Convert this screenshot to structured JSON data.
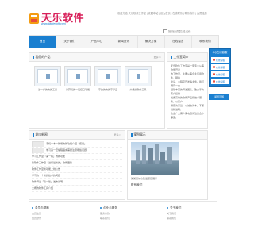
{
  "brand": {
    "title": "天乐软件",
    "subtitle": "www.tianlesoft.com"
  },
  "top_links": "欢迎光临 天乐软件工作室 | 收藏本站 | 设为首页 | 在线联系 | 联系我们 | 会员注册",
  "contact": {
    "email": "tianlesoft@163.com"
  },
  "nav": [
    {
      "label": "首页",
      "active": true
    },
    {
      "label": "关于我们"
    },
    {
      "label": "产品中心"
    },
    {
      "label": "新闻资讯"
    },
    {
      "label": "解决方案"
    },
    {
      "label": "在线留言"
    },
    {
      "label": "联系我们"
    }
  ],
  "products": {
    "title": "我们的产品",
    "more": "更多>>",
    "items": [
      {
        "label": "进一步的的的工具"
      },
      {
        "label": "计算机的一般接口功能"
      },
      {
        "label": "字的的的的字产品"
      },
      {
        "label": "大概的软件工具"
      }
    ]
  },
  "intro": {
    "title": "工作室简介",
    "more": "更多>>",
    "lines": [
      "天乐软件工作室是一家专业从事软件开发",
      "的工作室，主要从事企业应用软件、网站",
      "建设、小程序开发等业务。我们拥有一支",
      "经验丰富的开发团队，致力于为客户提供",
      "优质高效的软件产品和技术服务，以客户",
      "满意为宗旨，以诚信为本，不断创新进取，",
      "欢迎广大客户来电咨询洽谈合作事宜。"
    ]
  },
  "news": {
    "title": "站内新闻",
    "more": "更多>>",
    "items": [
      {
        "title": "手机一本一新增的新功能介绍「使用」",
        "date": ""
      },
      {
        "title": "学习第一套编程语言需要注意哪些问题",
        "date": ""
      },
      {
        "title": "学习工作室「第一版」的新功能",
        "date": ""
      },
      {
        "title": "新软件工作室「进行最新的」软件更新",
        "date": ""
      },
      {
        "title": "软件工作室新功能上线公告",
        "date": ""
      },
      {
        "title": "学习的一个新的技术的问题",
        "date": ""
      },
      {
        "title": "软件开发「第一版」发布说明",
        "date": ""
      },
      {
        "title": "大概的软件工具介绍",
        "date": ""
      }
    ]
  },
  "cases": {
    "title": "案例展示",
    "caption": "某某某城市建设项目展示"
  },
  "contact_panel": {
    "title": "联系我们"
  },
  "float": {
    "head": "QQ在线客服",
    "buttons": [
      "在线客服",
      "在线客服",
      "在线客服",
      "在线客服"
    ],
    "top": "返回顶部"
  },
  "footer": [
    {
      "title": "会员与帮助",
      "links": [
        "会员注册",
        "会员登录"
      ]
    },
    {
      "title": "企业与服务",
      "links": [
        "服务条款",
        "联系我们"
      ]
    },
    {
      "title": "关于我们",
      "links": [
        "关于我们",
        "联系我们"
      ]
    }
  ],
  "colors": {
    "accent": "#1a7fd0",
    "brand": "#d8205a"
  }
}
